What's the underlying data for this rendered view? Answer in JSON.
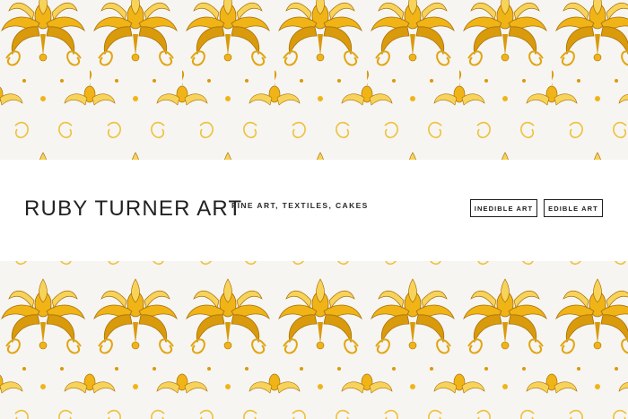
{
  "header": {
    "title": "RUBY TURNER ART",
    "tagline": "FINE ART, TEXTILES, CAKES"
  },
  "nav": {
    "items": [
      {
        "label": "INEDIBLE ART"
      },
      {
        "label": "EDIBLE ART"
      }
    ]
  },
  "background": {
    "pattern": "damask",
    "colors": {
      "gold_dark": "#d99a0b",
      "gold": "#f0b417",
      "gold_light": "#f7d35a",
      "cream": "#f6f5f1",
      "outline": "#a86f08"
    }
  }
}
